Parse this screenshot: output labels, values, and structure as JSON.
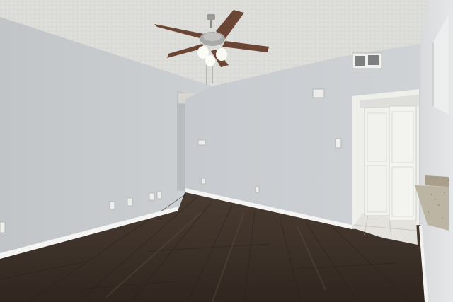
{
  "scene": {
    "subject": "empty-room-interior",
    "elements": [
      "ceiling-fan",
      "hvac-vent",
      "closet-doors",
      "hardwood-floor",
      "granite-countertop",
      "baseboards",
      "wall-outlets",
      "light-switch",
      "thermostat"
    ]
  },
  "colors": {
    "wall_left": "#c6c9cc",
    "wall_back": "#cbced2",
    "ceiling": "#dcdcd8",
    "floor": "#3b3029",
    "door": "#f1f1ee",
    "tile": "#e3e2dc",
    "counter": "#bdb5a3",
    "fan_blade": "#6b4634",
    "trim": "#f4f4f2"
  },
  "fan": {
    "blades": 5,
    "lights": 3
  }
}
